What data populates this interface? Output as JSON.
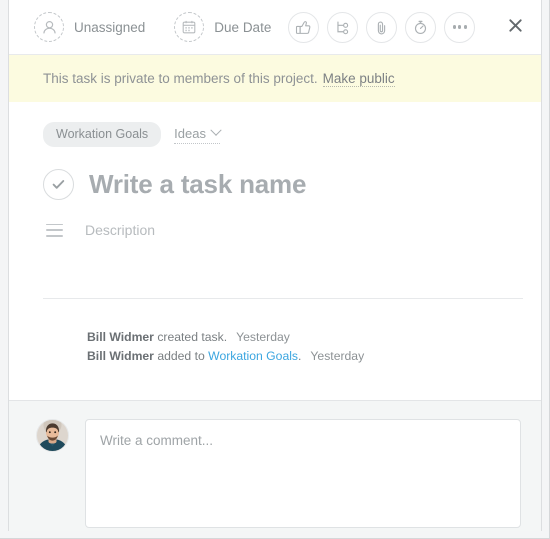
{
  "header": {
    "assignee": {
      "icon": "person-icon",
      "label": "Unassigned"
    },
    "due_date": {
      "icon": "calendar-icon",
      "label": "Due Date"
    },
    "actions": [
      {
        "name": "like-button",
        "icon": "thumbs-up-icon",
        "title": "Like"
      },
      {
        "name": "subtask-button",
        "icon": "subtask-tree-icon",
        "title": "Add subtask"
      },
      {
        "name": "attachment-button",
        "icon": "paperclip-icon",
        "title": "Attach file"
      },
      {
        "name": "timer-button",
        "icon": "stopwatch-icon",
        "title": "Track time"
      },
      {
        "name": "more-button",
        "icon": "ellipsis-icon",
        "title": "More actions"
      }
    ],
    "close": {
      "icon": "close-icon",
      "title": "Close"
    }
  },
  "banner": {
    "message": "This task is private to members of this project.",
    "action_label": "Make public",
    "background_color": "#fcfbe0"
  },
  "breadcrumb": {
    "project_pill": "Workation Goals",
    "section_label": "Ideas",
    "chevron_icon": "chevron-down-icon"
  },
  "task": {
    "complete_icon": "check-circle-icon",
    "title": "Write a task name",
    "description_icon": "list-lines-icon",
    "description_placeholder": "Description"
  },
  "activity": [
    {
      "actor": "Bill Widmer",
      "text_before": " created task.",
      "link": "",
      "text_after": "",
      "timestamp": "Yesterday"
    },
    {
      "actor": "Bill Widmer",
      "text_before": " added to ",
      "link": "Workation Goals",
      "text_after": ".",
      "timestamp": "Yesterday"
    }
  ],
  "comment": {
    "avatar_name": "avatar",
    "placeholder": "Write a comment...",
    "value": ""
  },
  "colors": {
    "link": "#3ca6e0",
    "banner_bg": "#fcfbe0",
    "pill_bg": "#eceeef",
    "muted_text": "#8b9194"
  }
}
